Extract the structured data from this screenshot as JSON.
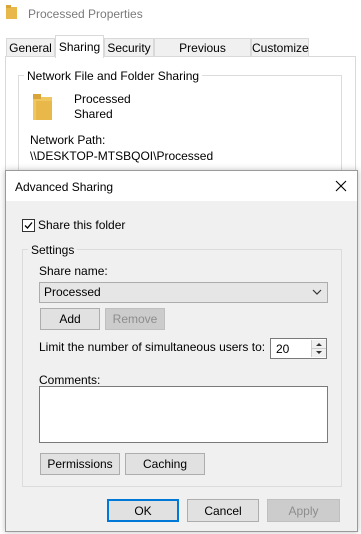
{
  "properties_window": {
    "title": "Processed Properties",
    "tabs": [
      {
        "label": "General",
        "active": false
      },
      {
        "label": "Sharing",
        "active": true
      },
      {
        "label": "Security",
        "active": false
      },
      {
        "label": "Previous Versions",
        "active": false
      },
      {
        "label": "Customize",
        "active": false
      }
    ],
    "group_title": "Network File and Folder Sharing",
    "folder_name": "Processed",
    "share_status": "Shared",
    "network_path_label": "Network Path:",
    "network_path_value": "\\\\DESKTOP-MTSBQOI\\Processed"
  },
  "dialog": {
    "title": "Advanced Sharing",
    "share_checkbox": {
      "label": "Share this folder",
      "checked": true
    },
    "settings": {
      "legend": "Settings",
      "share_name_label": "Share name:",
      "share_name_value": "Processed",
      "add_label": "Add",
      "remove_label": "Remove",
      "limit_label": "Limit the number of simultaneous users to:",
      "limit_value": "20",
      "comments_label": "Comments:",
      "comments_value": "",
      "permissions_label": "Permissions",
      "caching_label": "Caching"
    },
    "buttons": {
      "ok": "OK",
      "cancel": "Cancel",
      "apply": "Apply"
    }
  },
  "colors": {
    "accent": "#0078d7",
    "folder": "#e8b94a"
  }
}
